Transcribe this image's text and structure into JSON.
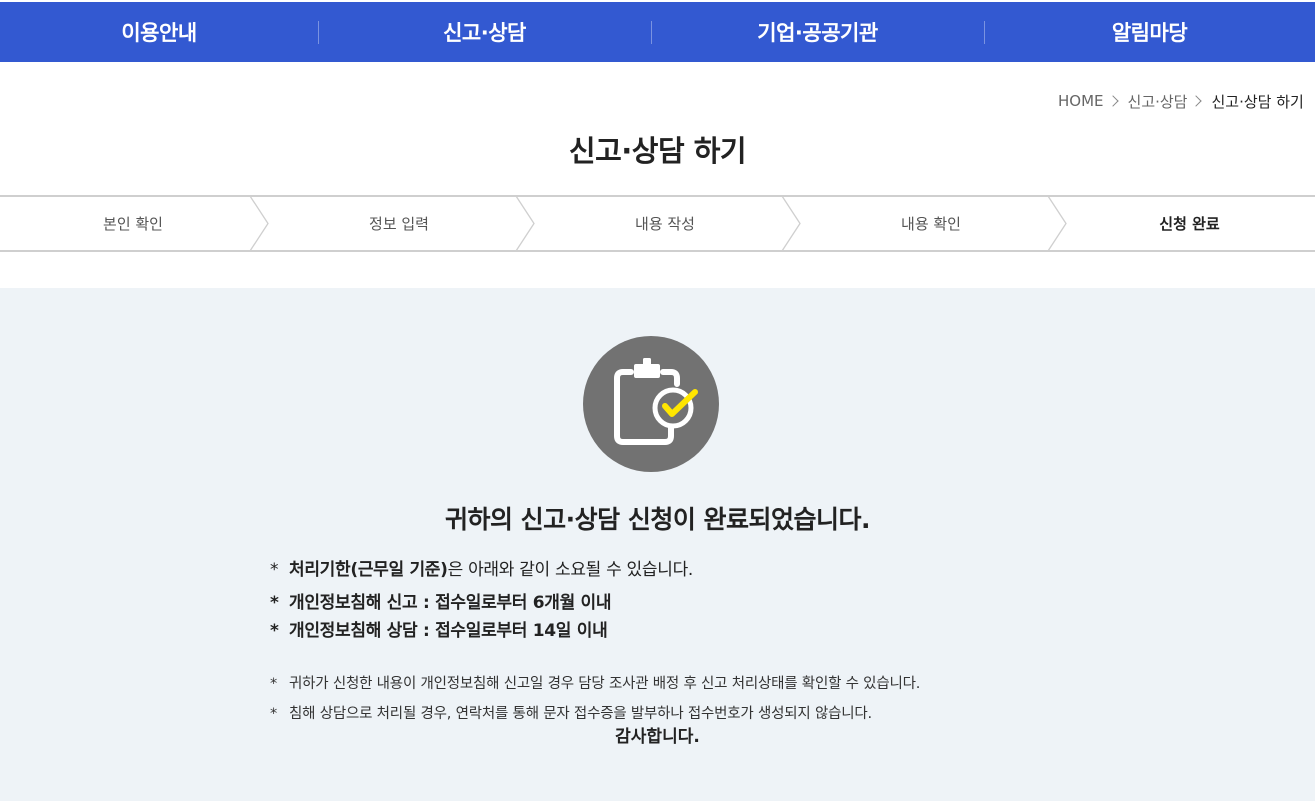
{
  "nav": {
    "items": [
      {
        "label": "이용안내"
      },
      {
        "label": "신고·상담"
      },
      {
        "label": "기업·공공기관"
      },
      {
        "label": "알림마당"
      }
    ]
  },
  "breadcrumb": {
    "home": "HOME",
    "level1": "신고·상담",
    "current": "신고·상담 하기"
  },
  "page": {
    "title": "신고·상담 하기"
  },
  "steps": [
    {
      "label": "본인 확인"
    },
    {
      "label": "정보 입력"
    },
    {
      "label": "내용 작성"
    },
    {
      "label": "내용 확인"
    },
    {
      "label": "신청 완료"
    }
  ],
  "completion": {
    "icon": "clipboard-check-icon",
    "message": "귀하의 신고·상담 신청이 완료되었습니다.",
    "star": "*",
    "notice_lead": "처리기한(근무일 기준)",
    "notice_rest": "은 아래와 같이 소요될 수 있습니다.",
    "deadline_report": "개인정보침해 신고 : 접수일로부터 6개월 이내",
    "deadline_consult": "개인정보침해 상담 : 접수일로부터 14일 이내",
    "note1": "귀하가 신청한 내용이 개인정보침해 신고일 경우 담당 조사관 배정 후 신고 처리상태를 확인할 수 있습니다.",
    "note2": "침해 상담으로 처리될 경우, 연락처를 통해 문자 접수증을 발부하나 접수번호가 생성되지 않습니다.",
    "thanks": "감사합니다."
  },
  "colors": {
    "nav_bg": "#3359d1",
    "content_bg": "#eef3f7",
    "icon_circle": "#727272",
    "check_accent": "#ffe600"
  }
}
